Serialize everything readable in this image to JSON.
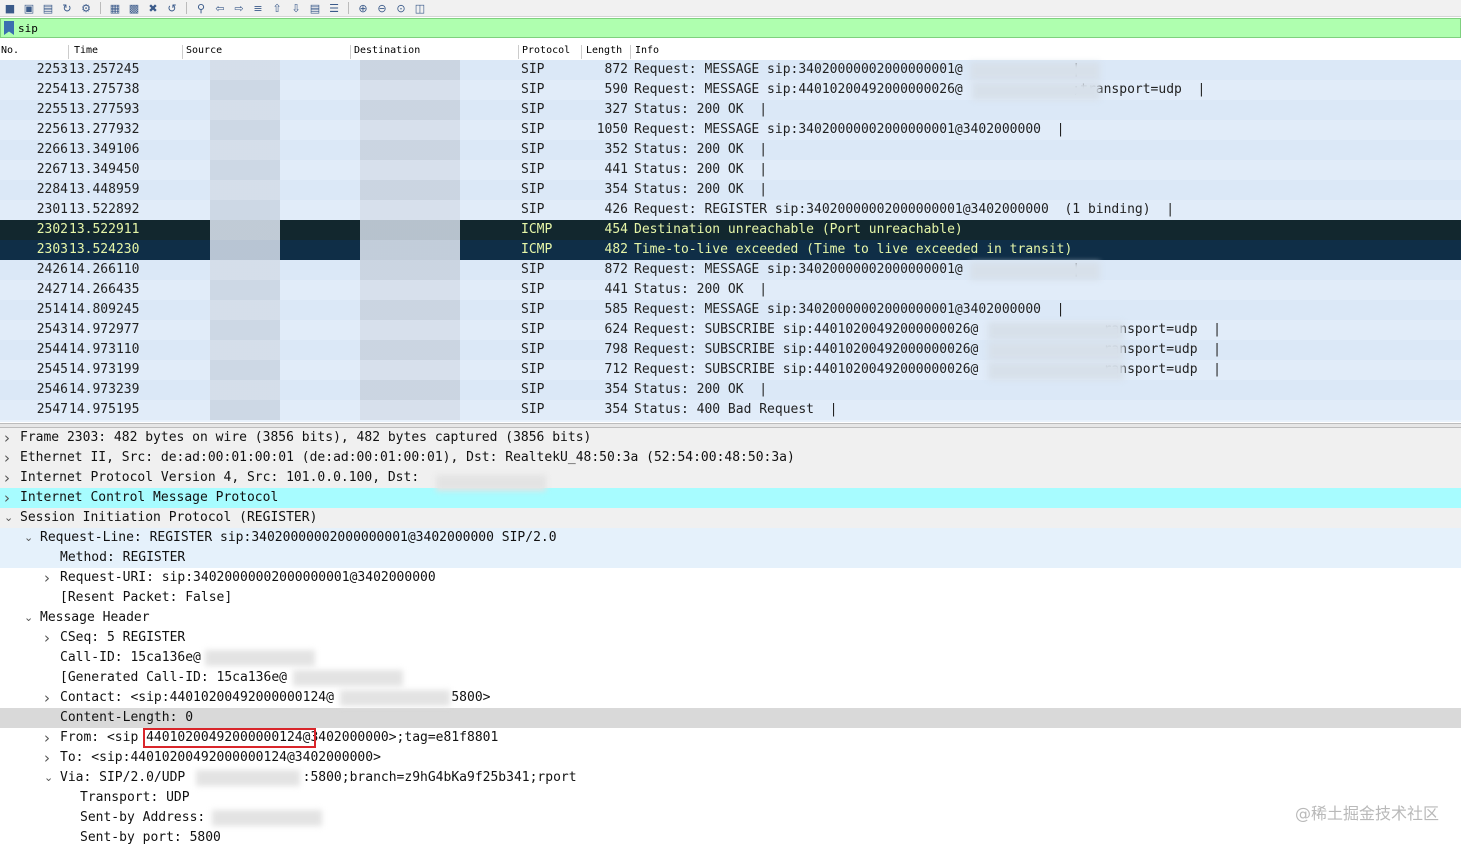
{
  "toolbar": {
    "icons": [
      "open-icon",
      "save-icon",
      "close-file-icon",
      "reload-icon",
      "options-icon",
      "folder-icon",
      "find-icon",
      "go-back-icon",
      "go-forward-icon",
      "go-to-packet-icon",
      "first-packet-icon",
      "last-packet-icon",
      "autoscroll-icon",
      "colorize-icon",
      "zoom-in-icon",
      "zoom-out-icon",
      "normal-size-icon",
      "resize-columns-icon"
    ]
  },
  "filter": {
    "value": "sip",
    "background": "#afffaf"
  },
  "columns": {
    "no": "No.",
    "time": "Time",
    "source": "Source",
    "destination": "Destination",
    "protocol": "Protocol",
    "length": "Length",
    "info": "Info"
  },
  "packets": [
    {
      "no": "2253",
      "time": "13.257245",
      "protocol": "SIP",
      "length": "872",
      "info": "Request: MESSAGE sip:34020000002000000001@              |"
    },
    {
      "no": "2254",
      "time": "13.275738",
      "protocol": "SIP",
      "length": "590",
      "info": "Request: MESSAGE sip:44010200492000000026@              ;transport=udp  |"
    },
    {
      "no": "2255",
      "time": "13.277593",
      "protocol": "SIP",
      "length": "327",
      "info": "Status: 200 OK  |"
    },
    {
      "no": "2256",
      "time": "13.277932",
      "protocol": "SIP",
      "length": "1050",
      "info": "Request: MESSAGE sip:34020000002000000001@3402000000  |"
    },
    {
      "no": "2266",
      "time": "13.349106",
      "protocol": "SIP",
      "length": "352",
      "info": "Status: 200 OK  |"
    },
    {
      "no": "2267",
      "time": "13.349450",
      "protocol": "SIP",
      "length": "441",
      "info": "Status: 200 OK  |"
    },
    {
      "no": "2284",
      "time": "13.448959",
      "protocol": "SIP",
      "length": "354",
      "info": "Status: 200 OK  |"
    },
    {
      "no": "2301",
      "time": "13.522892",
      "protocol": "SIP",
      "length": "426",
      "info": "Request: REGISTER sip:34020000002000000001@3402000000  (1 binding)  |"
    },
    {
      "no": "2302",
      "time": "13.522911",
      "protocol": "ICMP",
      "length": "454",
      "info": "Destination unreachable (Port unreachable)"
    },
    {
      "no": "2303",
      "time": "13.524230",
      "protocol": "ICMP",
      "length": "482",
      "info": "Time-to-live exceeded (Time to live exceeded in transit)"
    },
    {
      "no": "2426",
      "time": "14.266110",
      "protocol": "SIP",
      "length": "872",
      "info": "Request: MESSAGE sip:34020000002000000001@              |"
    },
    {
      "no": "2427",
      "time": "14.266435",
      "protocol": "SIP",
      "length": "441",
      "info": "Status: 200 OK  |"
    },
    {
      "no": "2514",
      "time": "14.809245",
      "protocol": "SIP",
      "length": "585",
      "info": "Request: MESSAGE sip:34020000002000000001@3402000000  |"
    },
    {
      "no": "2543",
      "time": "14.972977",
      "protocol": "SIP",
      "length": "624",
      "info": "Request: SUBSCRIBE sip:44010200492000000026@                ransport=udp  |"
    },
    {
      "no": "2544",
      "time": "14.973110",
      "protocol": "SIP",
      "length": "798",
      "info": "Request: SUBSCRIBE sip:44010200492000000026@                ransport=udp  |"
    },
    {
      "no": "2545",
      "time": "14.973199",
      "protocol": "SIP",
      "length": "712",
      "info": "Request: SUBSCRIBE sip:44010200492000000026@                ransport=udp  |"
    },
    {
      "no": "2546",
      "time": "14.973239",
      "protocol": "SIP",
      "length": "354",
      "info": "Status: 200 OK  |"
    },
    {
      "no": "2547",
      "time": "14.975195",
      "protocol": "SIP",
      "length": "354",
      "info": "Status: 400 Bad Request  |"
    }
  ],
  "details": [
    {
      "text": "Frame 2303: 482 bytes on wire (3856 bits), 482 bytes captured (3856 bits)",
      "indent": 0,
      "arrow": "right"
    },
    {
      "text": "Ethernet II, Src: de:ad:00:01:00:01 (de:ad:00:01:00:01), Dst: RealtekU_48:50:3a (52:54:00:48:50:3a)",
      "indent": 0,
      "arrow": "right"
    },
    {
      "text": "Internet Protocol Version 4, Src: 101.0.0.100, Dst: ",
      "indent": 0,
      "arrow": "right"
    },
    {
      "text": "Internet Control Message Protocol",
      "indent": 0,
      "arrow": "right"
    },
    {
      "text": "Session Initiation Protocol (REGISTER)",
      "indent": 0,
      "arrow": "down"
    },
    {
      "text": "Request-Line: REGISTER sip:34020000002000000001@3402000000 SIP/2.0",
      "indent": 1,
      "arrow": "down"
    },
    {
      "text": "Method: REGISTER",
      "indent": 2,
      "arrow": ""
    },
    {
      "text": "Request-URI: sip:34020000002000000001@3402000000",
      "indent": 2,
      "arrow": "right"
    },
    {
      "text": "[Resent Packet: False]",
      "indent": 2,
      "arrow": ""
    },
    {
      "text": "Message Header",
      "indent": 1,
      "arrow": "down"
    },
    {
      "text": "CSeq: 5 REGISTER",
      "indent": 2,
      "arrow": "right"
    },
    {
      "text": "Call-ID: 15ca136e@",
      "indent": 2,
      "arrow": ""
    },
    {
      "text": "[Generated Call-ID: 15ca136e@",
      "indent": 2,
      "arrow": ""
    },
    {
      "text": "Contact: <sip:44010200492000000124@               5800>",
      "indent": 2,
      "arrow": "right"
    },
    {
      "text": "Content-Length: 0",
      "indent": 2,
      "arrow": ""
    },
    {
      "text": "From: <sip 44010200492000000124@3402000000>;tag=e81f8801",
      "indent": 2,
      "arrow": "right"
    },
    {
      "text": "To: <sip:44010200492000000124@3402000000>",
      "indent": 2,
      "arrow": "right"
    },
    {
      "text": "Via: SIP/2.0/UDP               :5800;branch=z9hG4bKa9f25b341;rport",
      "indent": 2,
      "arrow": "down"
    },
    {
      "text": "Transport: UDP",
      "indent": 3,
      "arrow": ""
    },
    {
      "text": "Sent-by Address: ",
      "indent": 3,
      "arrow": ""
    },
    {
      "text": "Sent-by port: 5800",
      "indent": 3,
      "arrow": ""
    }
  ],
  "watermark": "@稀土掘金技术社区"
}
